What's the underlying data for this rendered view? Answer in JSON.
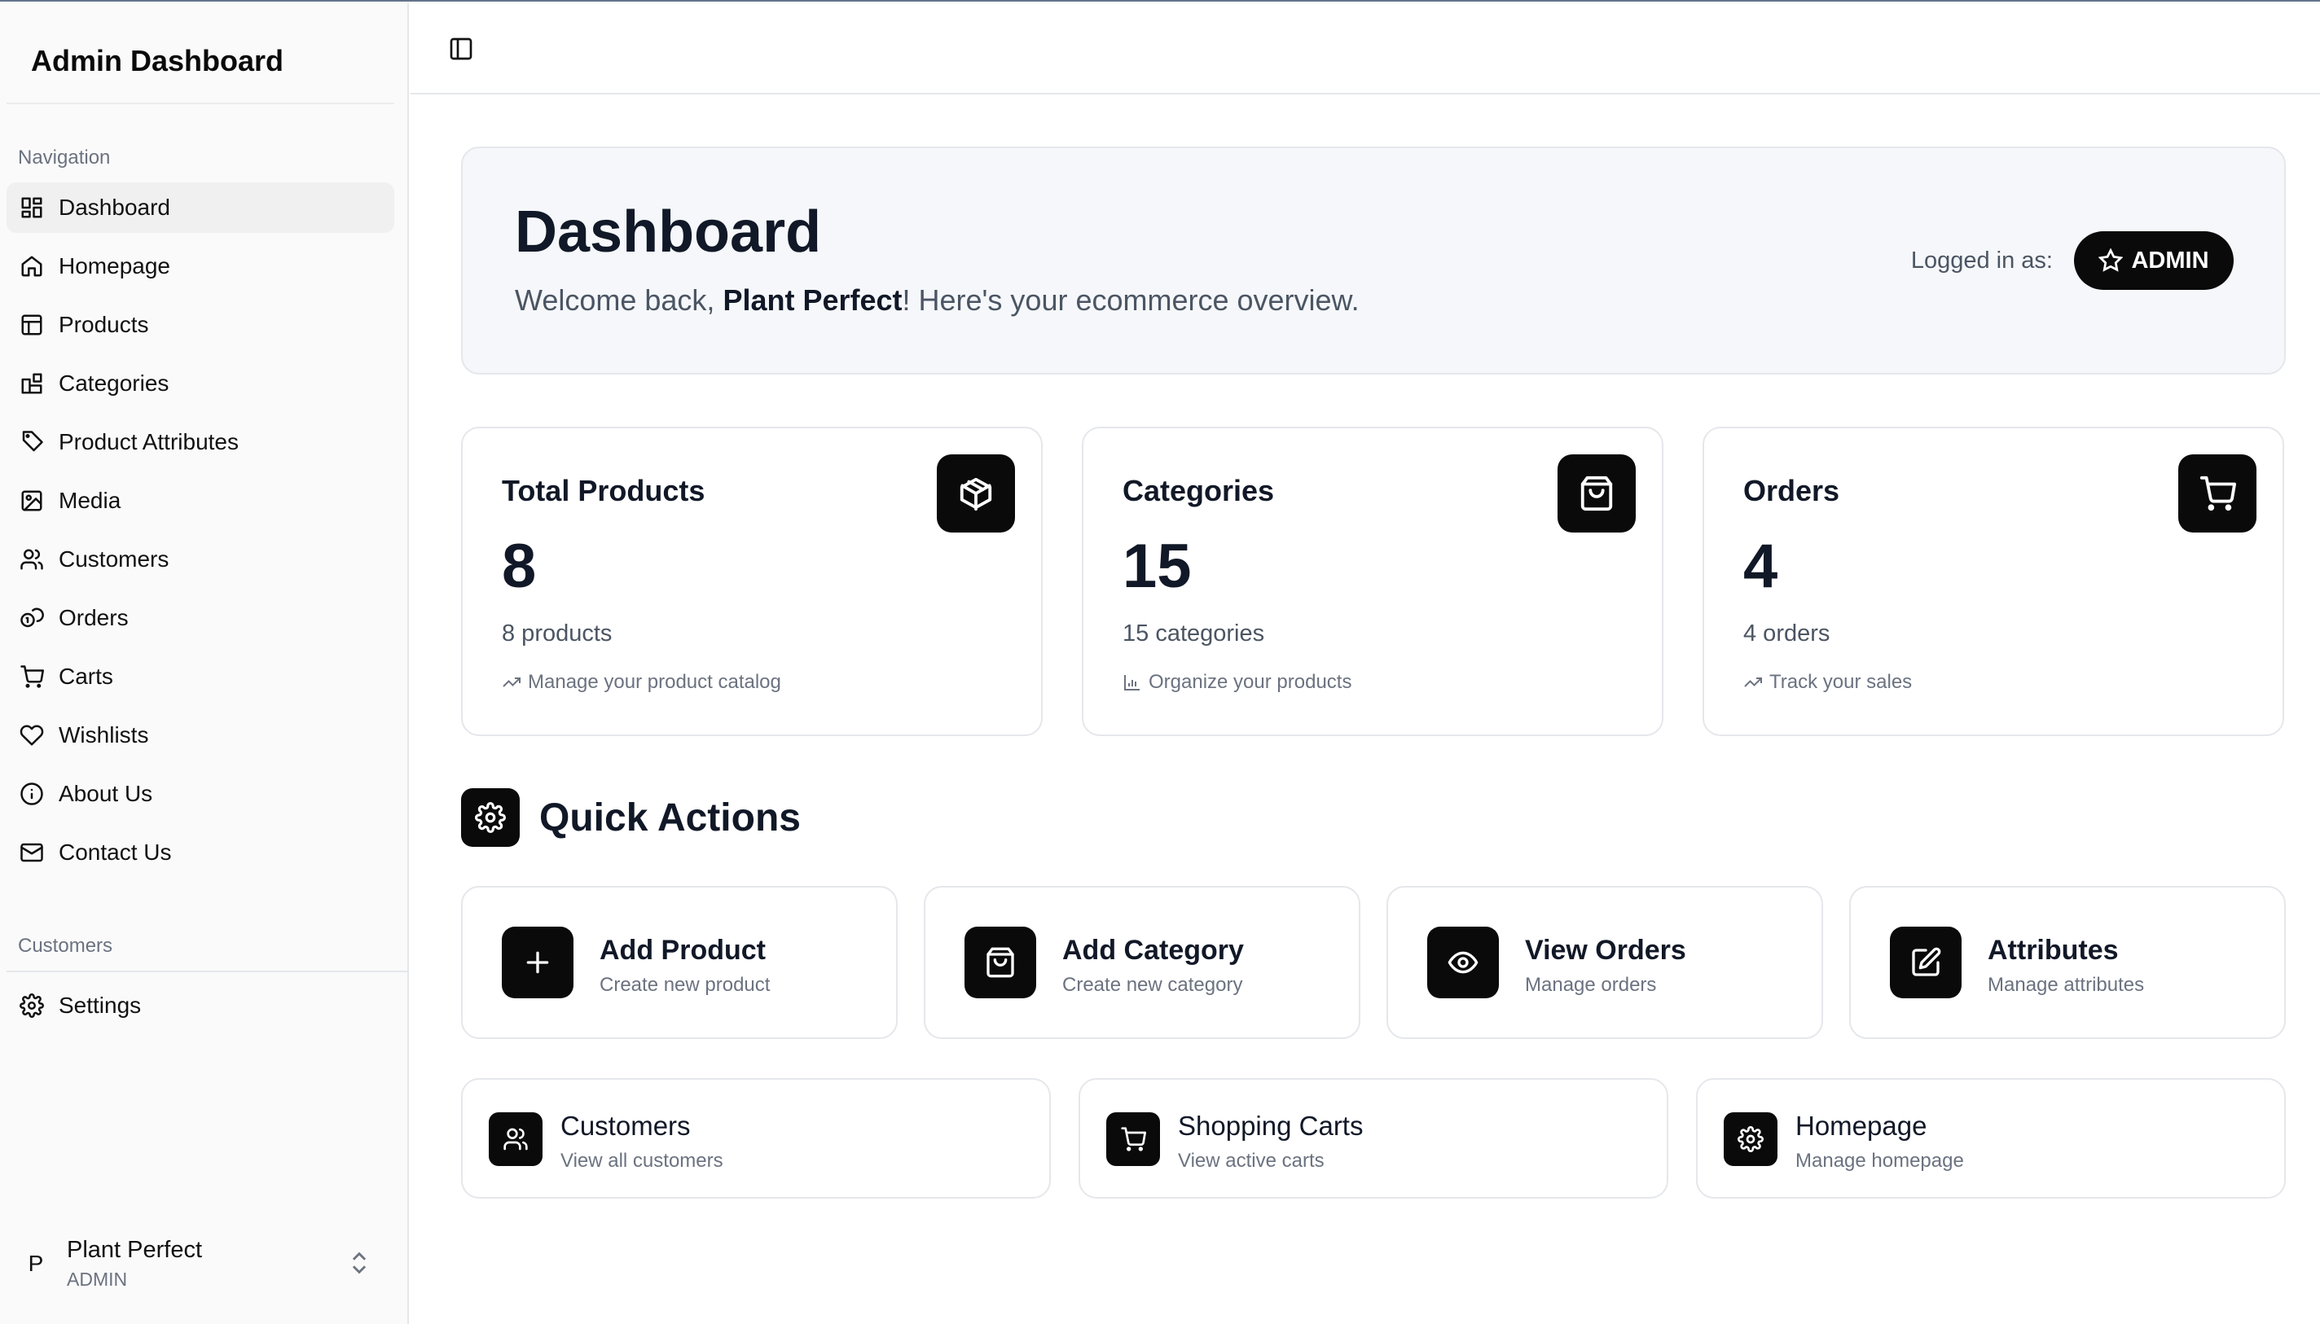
{
  "sidebar": {
    "title": "Admin Dashboard",
    "nav_label": "Navigation",
    "items": [
      {
        "label": "Dashboard",
        "icon": "layout-grid-icon"
      },
      {
        "label": "Homepage",
        "icon": "home-icon"
      },
      {
        "label": "Products",
        "icon": "table-layout-icon"
      },
      {
        "label": "Categories",
        "icon": "blocks-icon"
      },
      {
        "label": "Product Attributes",
        "icon": "tag-icon"
      },
      {
        "label": "Media",
        "icon": "image-icon"
      },
      {
        "label": "Customers",
        "icon": "users-icon"
      },
      {
        "label": "Orders",
        "icon": "coins-icon"
      },
      {
        "label": "Carts",
        "icon": "cart-icon"
      },
      {
        "label": "Wishlists",
        "icon": "heart-icon"
      },
      {
        "label": "About Us",
        "icon": "info-icon"
      },
      {
        "label": "Contact Us",
        "icon": "mail-icon"
      }
    ],
    "customers_label": "Customers",
    "settings_label": "Settings",
    "user": {
      "initial": "P",
      "name": "Plant Perfect",
      "role": "ADMIN"
    }
  },
  "hero": {
    "title": "Dashboard",
    "welcome_prefix": "Welcome back, ",
    "store_name": "Plant Perfect",
    "welcome_suffix": "! Here's your ecommerce overview.",
    "logged_in_label": "Logged in as:",
    "role_badge": "ADMIN"
  },
  "stats": [
    {
      "title": "Total Products",
      "value": "8",
      "desc": "8 products",
      "foot": "Manage your product catalog",
      "icon": "package-icon",
      "foot_icon": "trending-up-icon"
    },
    {
      "title": "Categories",
      "value": "15",
      "desc": "15 categories",
      "foot": "Organize your products",
      "icon": "shopping-bag-icon",
      "foot_icon": "bar-chart-icon"
    },
    {
      "title": "Orders",
      "value": "4",
      "desc": "4 orders",
      "foot": "Track your sales",
      "icon": "cart-icon",
      "foot_icon": "trending-up-icon"
    }
  ],
  "quick_actions": {
    "title": "Quick Actions",
    "primary": [
      {
        "title": "Add Product",
        "sub": "Create new product",
        "icon": "plus-icon"
      },
      {
        "title": "Add Category",
        "sub": "Create new category",
        "icon": "shopping-bag-icon"
      },
      {
        "title": "View Orders",
        "sub": "Manage orders",
        "icon": "eye-icon"
      },
      {
        "title": "Attributes",
        "sub": "Manage attributes",
        "icon": "edit-icon"
      }
    ],
    "secondary": [
      {
        "title": "Customers",
        "sub": "View all customers",
        "icon": "users-icon"
      },
      {
        "title": "Shopping Carts",
        "sub": "View active carts",
        "icon": "cart-icon"
      },
      {
        "title": "Homepage",
        "sub": "Manage homepage",
        "icon": "gear-icon"
      }
    ]
  }
}
